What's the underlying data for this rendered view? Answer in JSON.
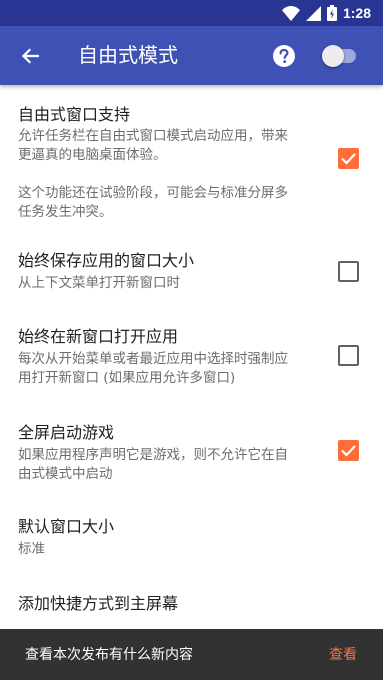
{
  "status_bar": {
    "time": "1:28",
    "icons": [
      "wifi-icon",
      "cell-signal-icon",
      "battery-icon"
    ]
  },
  "app_bar": {
    "back_icon": "arrow-back-icon",
    "title": "自由式模式",
    "help_icon": "help-icon",
    "master_switch_on": false
  },
  "settings": [
    {
      "title": "自由式窗口支持",
      "summary_lines": [
        "允许任务栏在自由式窗口模式启动应用，带来",
        "更逼真的电脑桌面体验。",
        "",
        "这个功能还在试验阶段，可能会与标准分屏多",
        "任务发生冲突。"
      ],
      "checked": true
    },
    {
      "title": "始终保存应用的窗口大小",
      "summary_lines": [
        "从上下文菜单打开新窗口时"
      ],
      "checked": false
    },
    {
      "title": "始终在新窗口打开应用",
      "summary_lines": [
        "每次从开始菜单或者最近应用中选择时强制应",
        "用打开新窗口 (如果应用允许多窗口)"
      ],
      "checked": false
    },
    {
      "title": "全屏启动游戏",
      "summary_lines": [
        "如果应用程序声明它是游戏，则不允许它在自",
        "由式模式中启动"
      ],
      "checked": true
    },
    {
      "title": "默认窗口大小",
      "summary_lines": [
        "标准"
      ]
    },
    {
      "title": "添加快捷方式到主屏幕",
      "summary_lines": []
    }
  ],
  "snackbar": {
    "message": "查看本次发布有什么新内容",
    "action": "查看"
  },
  "colors": {
    "primary": "#3f51b5",
    "primary_dark": "#283593",
    "accent": "#ff6d3a",
    "snackbar": "#323232"
  }
}
